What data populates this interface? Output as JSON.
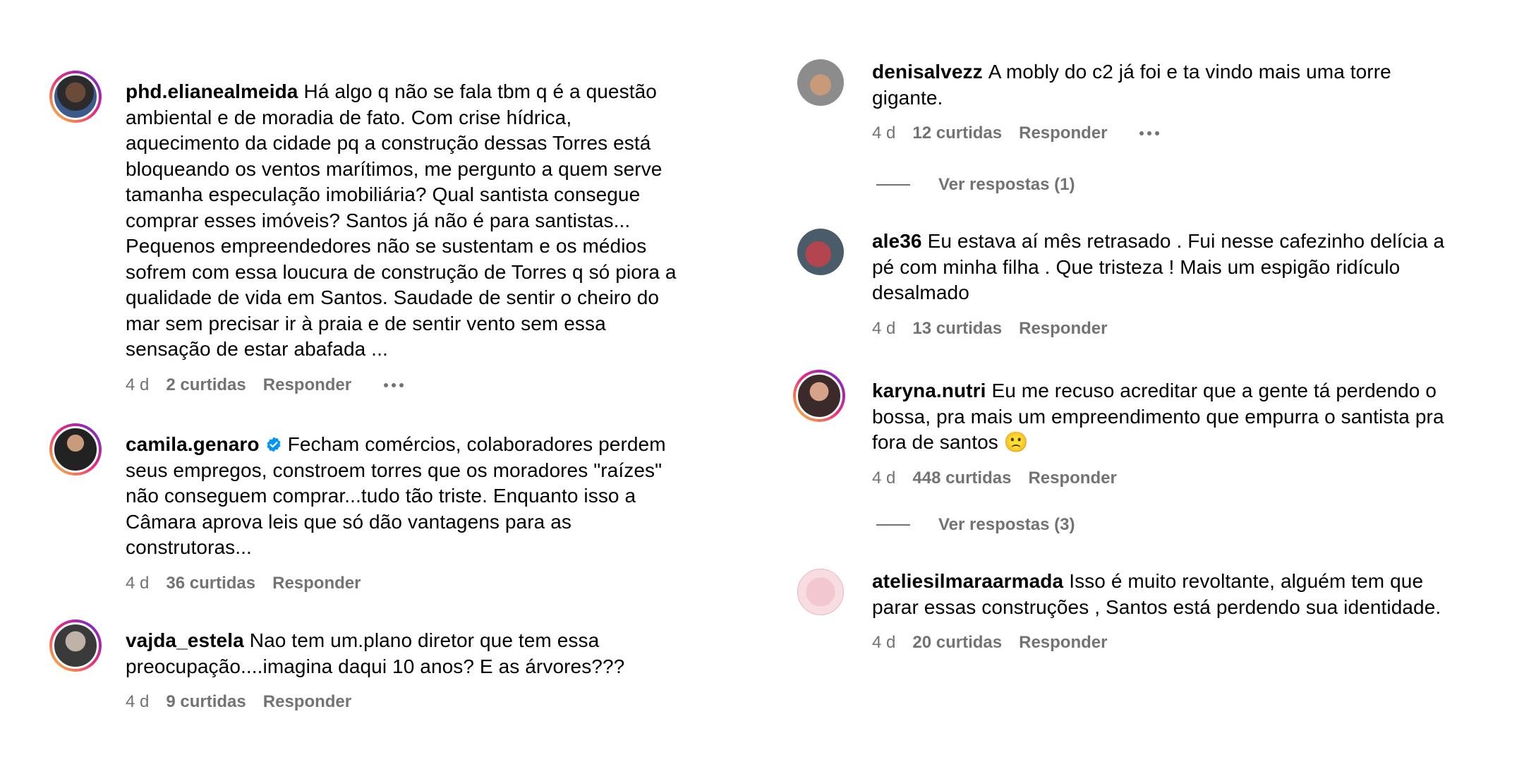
{
  "left_comments": [
    {
      "username": "phd.elianealmeida",
      "text": "Há algo q não se fala tbm q é a questão ambiental e de moradia de fato. Com crise hídrica, aquecimento da cidade pq a construção dessas Torres está bloqueando os ventos marítimos, me pergunto a quem serve tamanha especulação imobiliária? Qual santista consegue comprar esses imóveis? Santos já não é para santistas... Pequenos empreendedores não se sustentam e os médios sofrem com essa loucura de construção de Torres q só piora a qualidade de vida em Santos. Saudade de sentir o cheiro do mar sem precisar ir à praia e de sentir vento sem essa sensação de estar abafada ...",
      "time": "4 d",
      "likes": "2 curtidas",
      "reply": "Responder"
    },
    {
      "username": "camila.genaro",
      "text": "Fecham comércios, colaboradores perdem seus empregos, constroem torres que os moradores \"raízes\" não conseguem comprar...tudo tão triste. Enquanto isso a Câmara aprova leis que só dão vantagens para as construtoras...",
      "time": "4 d",
      "likes": "36 curtidas",
      "reply": "Responder"
    },
    {
      "username": "vajda_estela",
      "text": "Nao tem um.plano diretor que tem essa preocupação....imagina daqui 10 anos? E as árvores???",
      "time": "4 d",
      "likes": "9 curtidas",
      "reply": "Responder"
    }
  ],
  "right_comments": [
    {
      "username": "denisalvezz",
      "text": "A mobly do c2 já foi e ta vindo mais uma torre gigante.",
      "time": "4 d",
      "likes": "12 curtidas",
      "reply": "Responder",
      "view_replies": "Ver respostas (1)"
    },
    {
      "username": "ale36",
      "text": "Eu estava aí mês retrasado . Fui nesse cafezinho delícia a pé com minha filha . Que tristeza ! Mais um espigão ridículo desalmado",
      "time": "4 d",
      "likes": "13 curtidas",
      "reply": "Responder"
    },
    {
      "username": "karyna.nutri",
      "text": "Eu me recuso acreditar que a gente tá perdendo o bossa, pra mais um empreendimento que empurra o santista pra fora de santos 🙁",
      "time": "4 d",
      "likes": "448 curtidas",
      "reply": "Responder",
      "view_replies": "Ver respostas (3)"
    },
    {
      "username": "ateliesilmaraarmada",
      "text": "Isso é muito revoltante, alguém tem que parar essas construções , Santos está perdendo sua identidade.",
      "time": "4 d",
      "likes": "20 curtidas",
      "reply": "Responder"
    }
  ],
  "colors": {
    "meta": "#737373",
    "verified": "#0095f6",
    "story_ring_start": "#f9ce34",
    "story_ring_end": "#6228d7"
  },
  "icons": [
    "more-options-icon",
    "verified-badge-icon"
  ]
}
